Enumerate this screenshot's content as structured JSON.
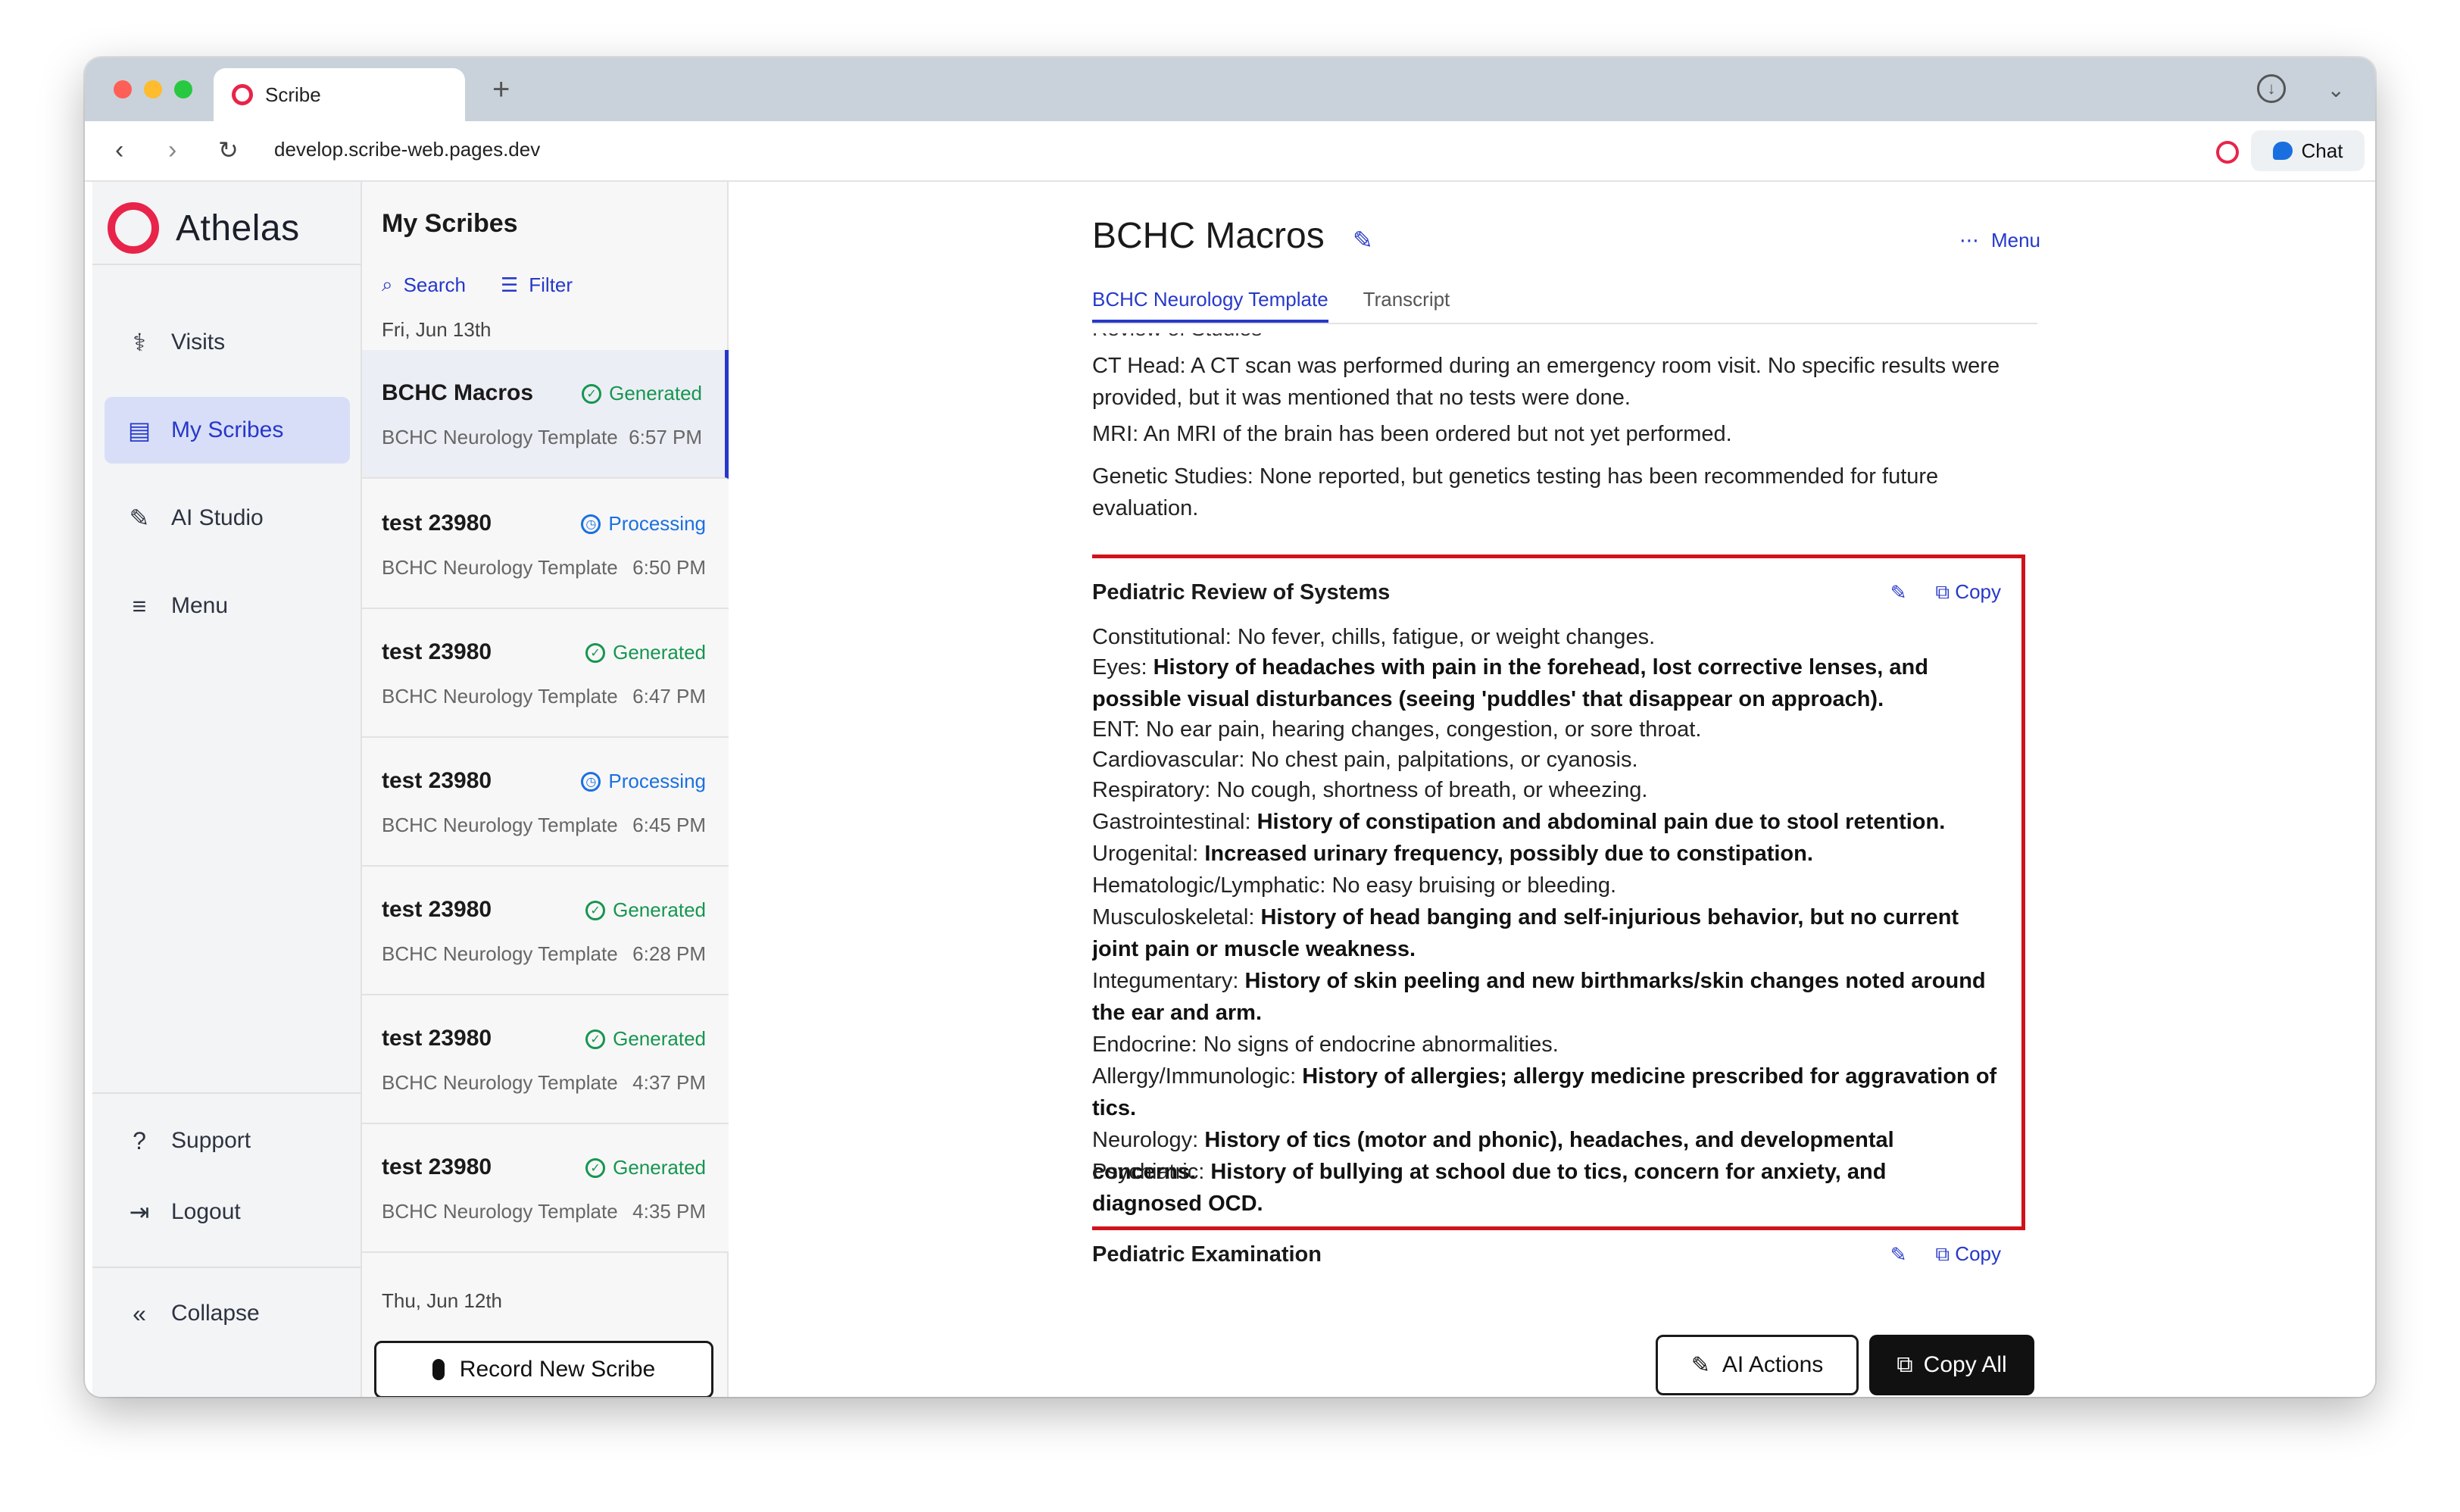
{
  "browser": {
    "tab_title": "Scribe",
    "new_tab": "+",
    "url": "develop.scribe-web.pages.dev",
    "chat_label": "Chat"
  },
  "sidebar": {
    "brand": "Athelas",
    "items": [
      {
        "label": "Visits",
        "icon": "stethoscope-icon"
      },
      {
        "label": "My Scribes",
        "icon": "document-icon",
        "active": true
      },
      {
        "label": "AI Studio",
        "icon": "magic-wand-icon"
      },
      {
        "label": "Menu",
        "icon": "hamburger-icon"
      }
    ],
    "bottom": [
      {
        "label": "Support",
        "icon": "help-icon"
      },
      {
        "label": "Logout",
        "icon": "logout-icon"
      }
    ],
    "collapse_label": "Collapse"
  },
  "scribe_list": {
    "title": "My Scribes",
    "search_label": "Search",
    "filter_label": "Filter",
    "date_groups": [
      "Fri, Jun 13th",
      "Thu, Jun 12th"
    ],
    "items": [
      {
        "name": "BCHC Macros",
        "status": "Generated",
        "template": "BCHC Neurology Template",
        "time": "6:57 PM"
      },
      {
        "name": "test 23980",
        "status": "Processing",
        "template": "BCHC Neurology Template",
        "time": "6:50 PM"
      },
      {
        "name": "test 23980",
        "status": "Generated",
        "template": "BCHC Neurology Template",
        "time": "6:47 PM"
      },
      {
        "name": "test 23980",
        "status": "Processing",
        "template": "BCHC Neurology Template",
        "time": "6:45 PM"
      },
      {
        "name": "test 23980",
        "status": "Generated",
        "template": "BCHC Neurology Template",
        "time": "6:28 PM"
      },
      {
        "name": "test 23980",
        "status": "Generated",
        "template": "BCHC Neurology Template",
        "time": "4:37 PM"
      },
      {
        "name": "test 23980",
        "status": "Generated",
        "template": "BCHC Neurology Template",
        "time": "4:35 PM"
      }
    ],
    "record_label": "Record New Scribe"
  },
  "main": {
    "title": "BCHC Macros",
    "menu_label": "Menu",
    "tabs": [
      "BCHC Neurology Template",
      "Transcript"
    ],
    "partial_header": "Review of Studies",
    "paragraphs": [
      "CT Head: A CT scan was performed during an emergency room visit. No specific results were provided, but it was mentioned that no tests were done.",
      "MRI: An MRI of the brain has been ordered but not yet performed.",
      "Genetic Studies: None reported, but genetics testing has been recommended for future evaluation."
    ],
    "ros_section": {
      "title": "Pediatric Review of Systems",
      "copy_label": "Copy",
      "lines": [
        {
          "label": "Constitutional: ",
          "text": "No fever, chills, fatigue, or weight changes.",
          "bold": false
        },
        {
          "label": "Eyes: ",
          "text": "History of headaches with pain in the forehead, lost corrective lenses, and possible visual disturbances (seeing 'puddles' that disappear on approach).",
          "bold": true
        },
        {
          "label": "ENT: ",
          "text": "No ear pain, hearing changes, congestion, or sore throat.",
          "bold": false
        },
        {
          "label": "Cardiovascular: ",
          "text": "No chest pain, palpitations, or cyanosis.",
          "bold": false
        },
        {
          "label": "Respiratory: ",
          "text": "No cough, shortness of breath, or wheezing.",
          "bold": false
        },
        {
          "label": "Gastrointestinal: ",
          "text": "History of constipation and abdominal pain due to stool retention.",
          "bold": true
        },
        {
          "label": "Urogenital: ",
          "text": "Increased urinary frequency, possibly due to constipation.",
          "bold": true
        },
        {
          "label": "Hematologic/Lymphatic: ",
          "text": "No easy bruising or bleeding.",
          "bold": false
        },
        {
          "label": "Musculoskeletal: ",
          "text": "History of head banging and self-injurious behavior, but no current joint pain or muscle weakness.",
          "bold": true
        },
        {
          "label": "Integumentary: ",
          "text": "History of skin peeling and new birthmarks/skin changes noted around the ear and arm.",
          "bold": true
        },
        {
          "label": "Endocrine: ",
          "text": "No signs of endocrine abnormalities.",
          "bold": false
        },
        {
          "label": "Allergy/Immunologic: ",
          "text": "History of allergies; allergy medicine prescribed for aggravation of tics.",
          "bold": true
        },
        {
          "label": "Neurology: ",
          "text": "History of tics (motor and phonic), headaches, and developmental concerns.",
          "bold": true
        },
        {
          "label": "Psychiatric: ",
          "text": "History of bullying at school due to tics, concern for anxiety, and diagnosed OCD.",
          "bold": true
        }
      ]
    },
    "exam_section": {
      "title": "Pediatric Examination",
      "copy_label": "Copy"
    },
    "ai_actions_label": "AI Actions",
    "copy_all_label": "Copy All"
  },
  "colors": {
    "accent": "#2638c9",
    "brand": "#e8244a",
    "generated": "#16964f",
    "processing": "#1b70e0",
    "highlight": "#d0121b"
  }
}
